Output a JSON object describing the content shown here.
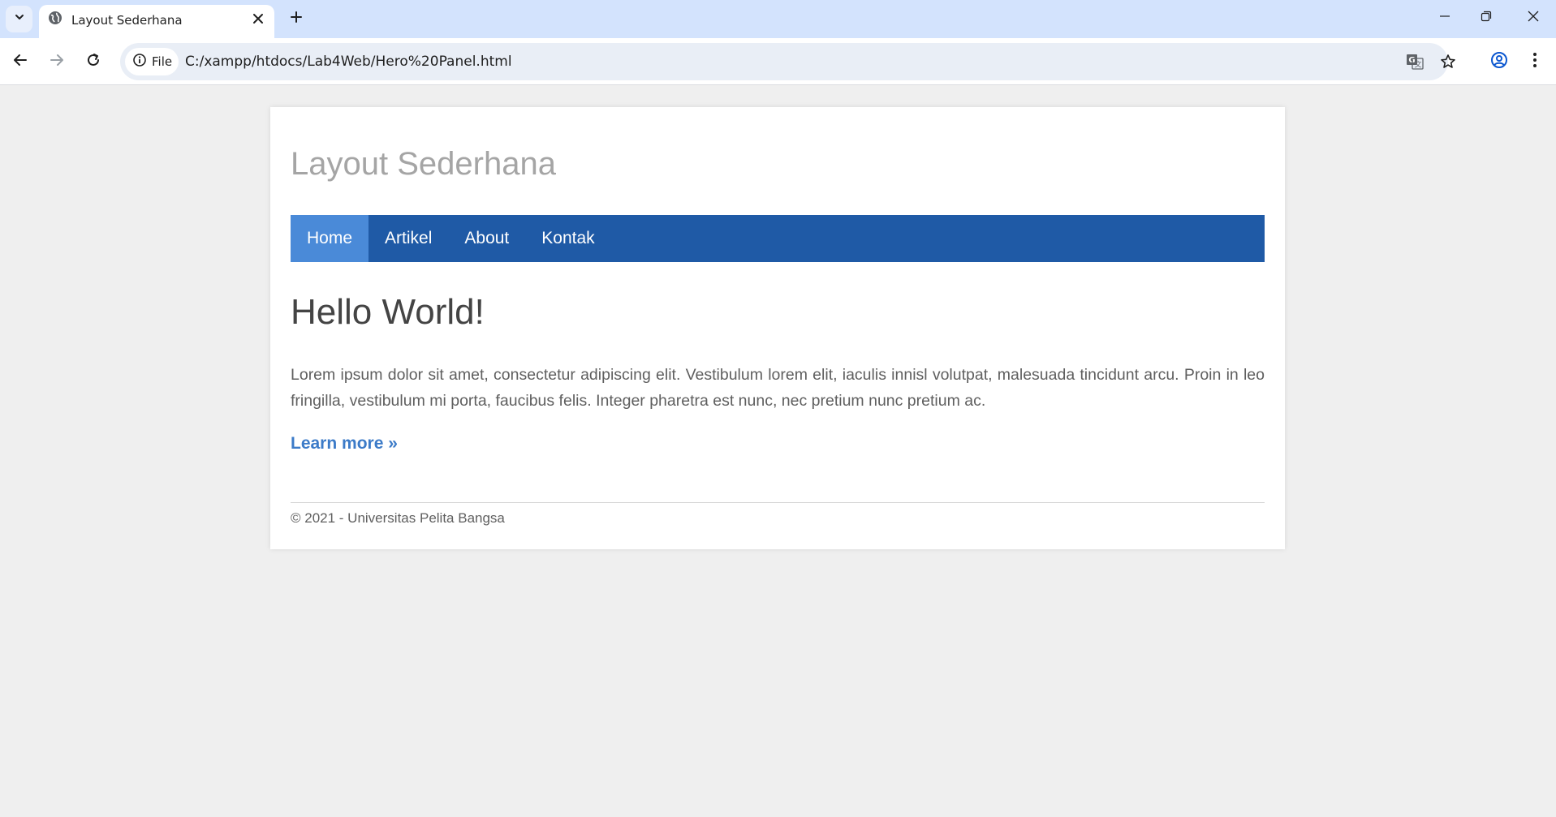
{
  "browser": {
    "tab": {
      "title": "Layout Sederhana",
      "favicon": "globe-icon"
    },
    "address_bar": {
      "chip_label": "File",
      "url": "C:/xampp/htdocs/Lab4Web/Hero%20Panel.html"
    },
    "icons": {
      "tab_search": "chevron-down-icon",
      "tab_close": "close-icon",
      "new_tab": "plus-icon",
      "back": "arrow-left-icon",
      "forward": "arrow-right-icon",
      "reload": "reload-icon",
      "site_info": "info-icon",
      "translate": "translate-icon",
      "bookmark": "star-icon",
      "profile": "profile-icon",
      "menu": "kebab-menu-icon",
      "minimize": "minimize-icon",
      "restore": "restore-icon",
      "close_window": "close-icon"
    },
    "colors": {
      "tabstrip": "#d3e3fd",
      "omnibox": "#e9eef6"
    }
  },
  "page": {
    "site_title": "Layout Sederhana",
    "nav": [
      {
        "label": "Home",
        "active": true
      },
      {
        "label": "Artikel",
        "active": false
      },
      {
        "label": "About",
        "active": false
      },
      {
        "label": "Kontak",
        "active": false
      }
    ],
    "hero": {
      "heading": "Hello World!",
      "text": "Lorem ipsum dolor sit amet, consectetur adipiscing elit. Vestibulum lorem elit, iaculis innisl volutpat, malesuada tincidunt arcu. Proin in leo fringilla, vestibulum mi porta, faucibus felis. Integer pharetra est nunc, nec pretium nunc pretium ac.",
      "link": "Learn more »"
    },
    "footer": {
      "text": "© 2021 - Universitas Pelita Bangsa"
    },
    "colors": {
      "nav_bg": "#1f5aa6",
      "nav_active": "#4a8ad8",
      "link": "#3c7bc8",
      "title": "#a5a5a5"
    }
  }
}
